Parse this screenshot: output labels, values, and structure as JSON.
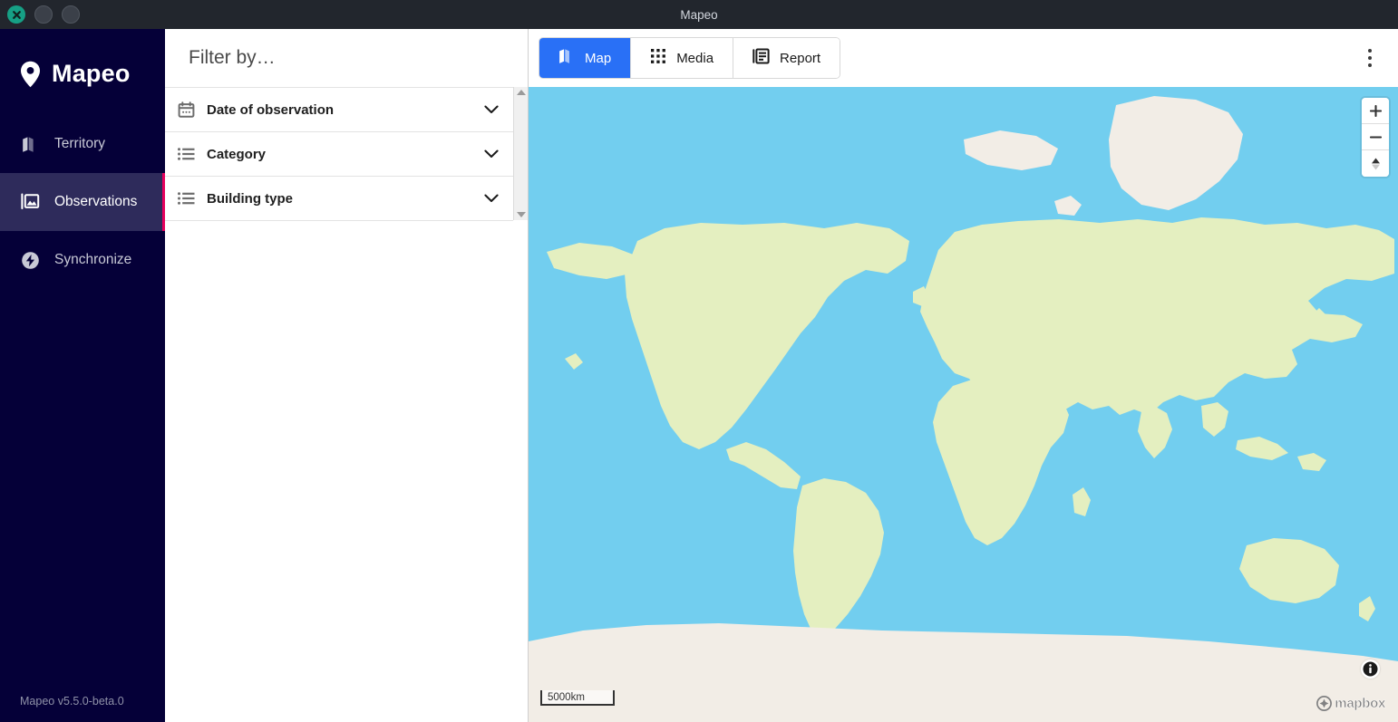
{
  "window": {
    "title": "Mapeo",
    "controls": [
      {
        "name": "close",
        "icon": "close-icon"
      },
      {
        "name": "minimize",
        "icon": "minimize-icon"
      },
      {
        "name": "maximize",
        "icon": "maximize-icon"
      }
    ]
  },
  "sidebar": {
    "brand": {
      "name": "Mapeo",
      "icon": "map-pin-icon"
    },
    "items": [
      {
        "label": "Territory",
        "icon": "map-icon",
        "active": false
      },
      {
        "label": "Observations",
        "icon": "photo-library-icon",
        "active": true
      },
      {
        "label": "Synchronize",
        "icon": "sync-bolt-icon",
        "active": false
      }
    ],
    "version": "Mapeo v5.5.0-beta.0",
    "bg_color": "#050038",
    "active_bg_color": "#2e2b5b",
    "active_marker_color": "#e6005c"
  },
  "filter_panel": {
    "title": "Filter by…",
    "rows": [
      {
        "label": "Date of observation",
        "icon": "calendar-icon",
        "chevron": "chevron-down-icon"
      },
      {
        "label": "Category",
        "icon": "list-icon",
        "chevron": "chevron-down-icon"
      },
      {
        "label": "Building type",
        "icon": "list-icon",
        "chevron": "chevron-down-icon"
      }
    ],
    "scrollbar": {
      "up": "scroll-up-arrow-icon",
      "down": "scroll-down-arrow-icon"
    }
  },
  "topbar": {
    "tabs": [
      {
        "label": "Map",
        "icon": "map-icon",
        "active": true
      },
      {
        "label": "Media",
        "icon": "grid-icon",
        "active": false
      },
      {
        "label": "Report",
        "icon": "report-icon",
        "active": false
      }
    ],
    "overflow_menu": "more-vertical-icon",
    "accent_color": "#2970f6"
  },
  "map": {
    "zoom_in": "+",
    "zoom_out": "−",
    "compass": "compass-north-icon",
    "scale_label": "5000km",
    "info": "info-icon",
    "attribution": "mapbox",
    "ocean_color": "#72ceef",
    "land_color": "#e4efc0",
    "ice_color": "#f2ede6"
  }
}
